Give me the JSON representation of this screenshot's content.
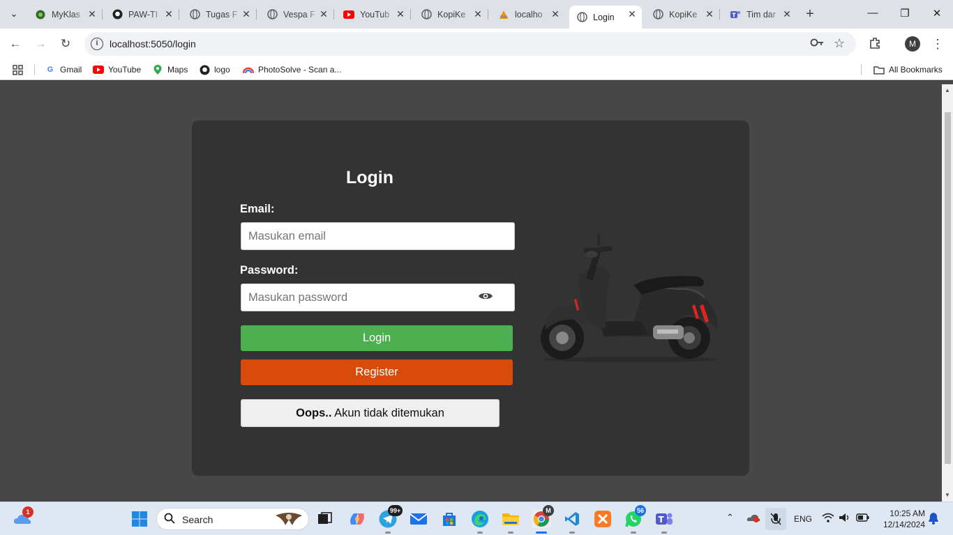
{
  "browser": {
    "tabs": [
      {
        "label": "MyKlas",
        "icon": "myklas-icon"
      },
      {
        "label": "PAW-TI",
        "icon": "github-icon"
      },
      {
        "label": "Tugas F",
        "icon": "globe-icon"
      },
      {
        "label": "Vespa F",
        "icon": "globe-icon"
      },
      {
        "label": "YouTub",
        "icon": "youtube-icon"
      },
      {
        "label": "KopiKe",
        "icon": "globe-icon"
      },
      {
        "label": "localho",
        "icon": "phpmyadmin-icon"
      },
      {
        "label": "Login",
        "icon": "globe-icon",
        "active": true
      },
      {
        "label": "KopiKe",
        "icon": "globe-icon"
      },
      {
        "label": "Tim dar",
        "icon": "teams-icon"
      }
    ],
    "url": "localhost:5050/login",
    "profile_initial": "M",
    "bookmarks": [
      {
        "label": "Gmail",
        "icon": "google-icon"
      },
      {
        "label": "YouTube",
        "icon": "youtube-icon"
      },
      {
        "label": "Maps",
        "icon": "maps-icon"
      },
      {
        "label": "logo",
        "icon": "github-icon"
      },
      {
        "label": "PhotoSolve - Scan a...",
        "icon": "photosolve-icon"
      }
    ],
    "all_bookmarks": "All Bookmarks"
  },
  "login": {
    "title": "Login",
    "email_label": "Email:",
    "email_placeholder": "Masukan email",
    "password_label": "Password:",
    "password_placeholder": "Masukan password",
    "login_button": "Login",
    "register_button": "Register",
    "alert_bold": "Oops..",
    "alert_text": " Akun tidak ditemukan"
  },
  "taskbar": {
    "search_label": "Search",
    "weather_badge": "1",
    "telegram_badge": "99+",
    "whatsapp_badge": "56",
    "chrome_badge": "M",
    "language": "ENG",
    "time": "10:25 AM",
    "date": "12/14/2024"
  },
  "colors": {
    "page_bg": "#474747",
    "card_bg": "#333333",
    "login_green": "#4caf50",
    "register_orange": "#d84b0b"
  }
}
